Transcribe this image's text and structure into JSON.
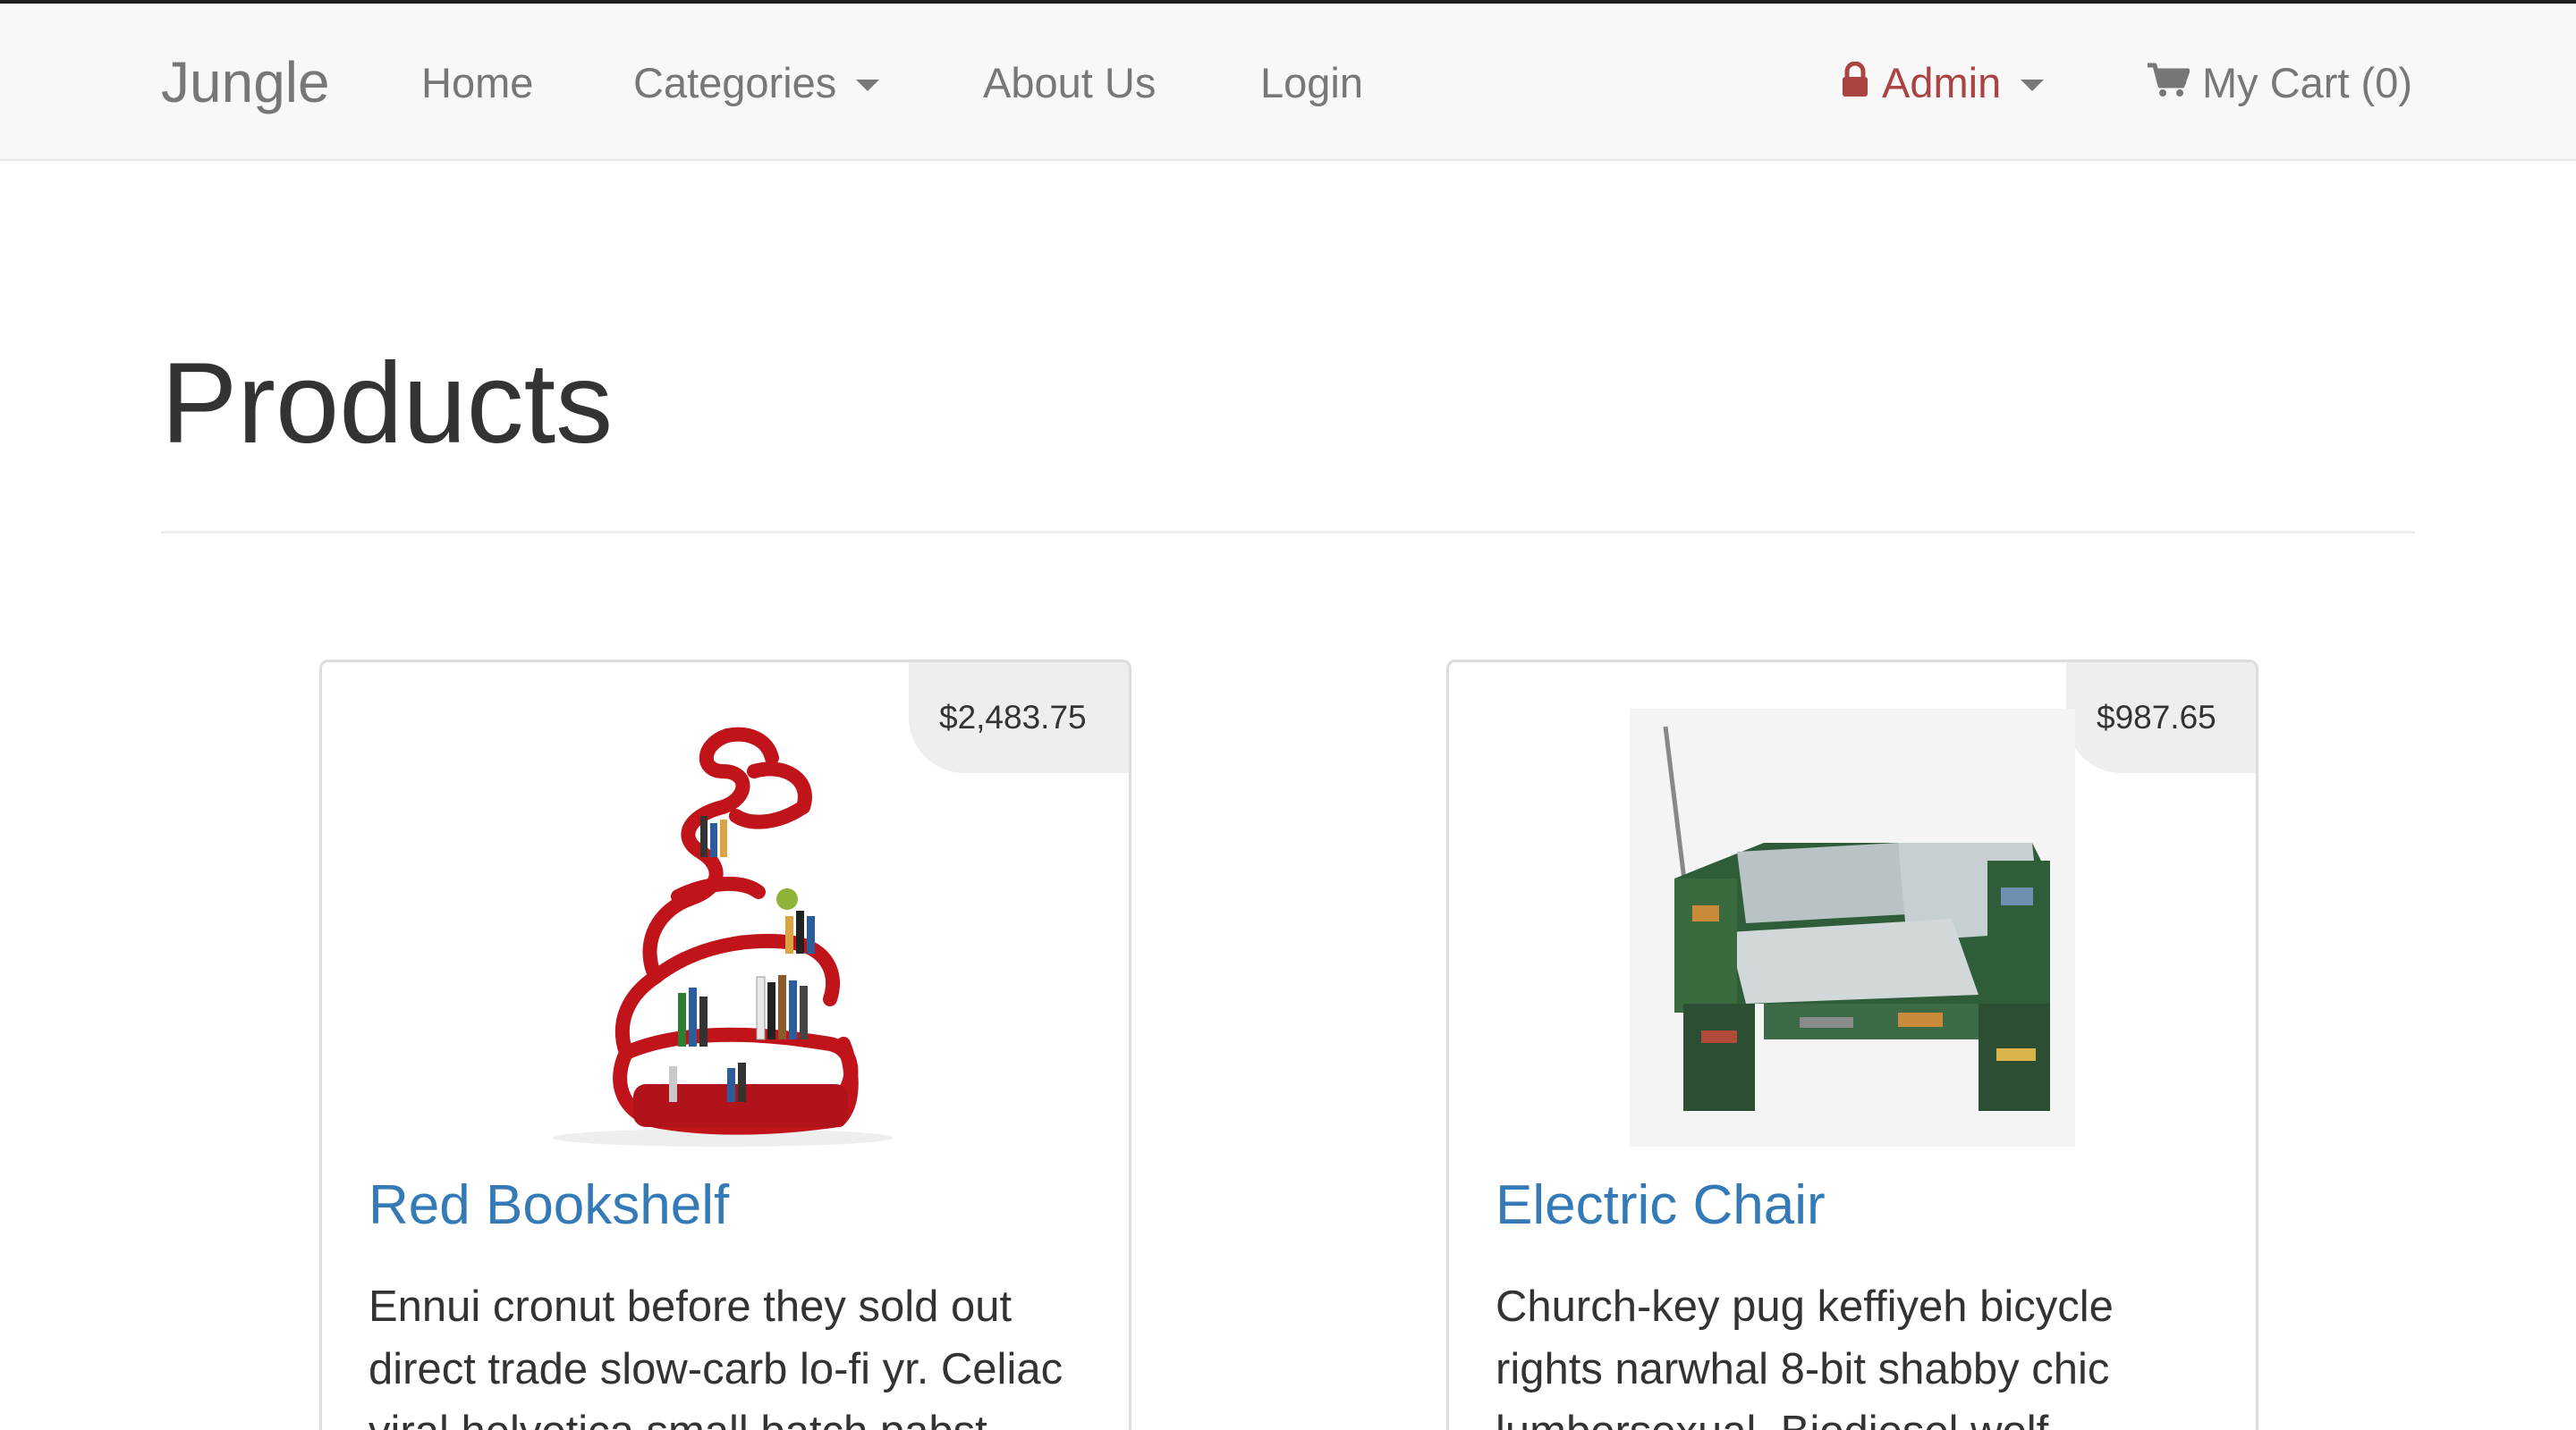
{
  "nav": {
    "brand": "Jungle",
    "home": "Home",
    "categories": "Categories",
    "about": "About Us",
    "login": "Login",
    "admin": "Admin",
    "cart": "My Cart (0)"
  },
  "page": {
    "title": "Products"
  },
  "products": [
    {
      "name": "Red Bookshelf",
      "price": "$2,483.75",
      "description": "Ennui cronut before they sold out direct trade slow-carb lo-fi yr. Celiac viral helvetica small batch pabst"
    },
    {
      "name": "Electric Chair",
      "price": "$987.65",
      "description": "Church-key pug keffiyeh bicycle rights narwhal 8-bit shabby chic lumbersexual. Biodiesel wolf"
    }
  ],
  "colors": {
    "link": "#337ab7",
    "admin": "#a94442",
    "nav_text": "#777777",
    "navbar_bg": "#f8f8f8"
  },
  "icons": {
    "admin": "lock-icon",
    "cart": "shopping-cart-icon",
    "dropdown": "caret-down-icon"
  }
}
